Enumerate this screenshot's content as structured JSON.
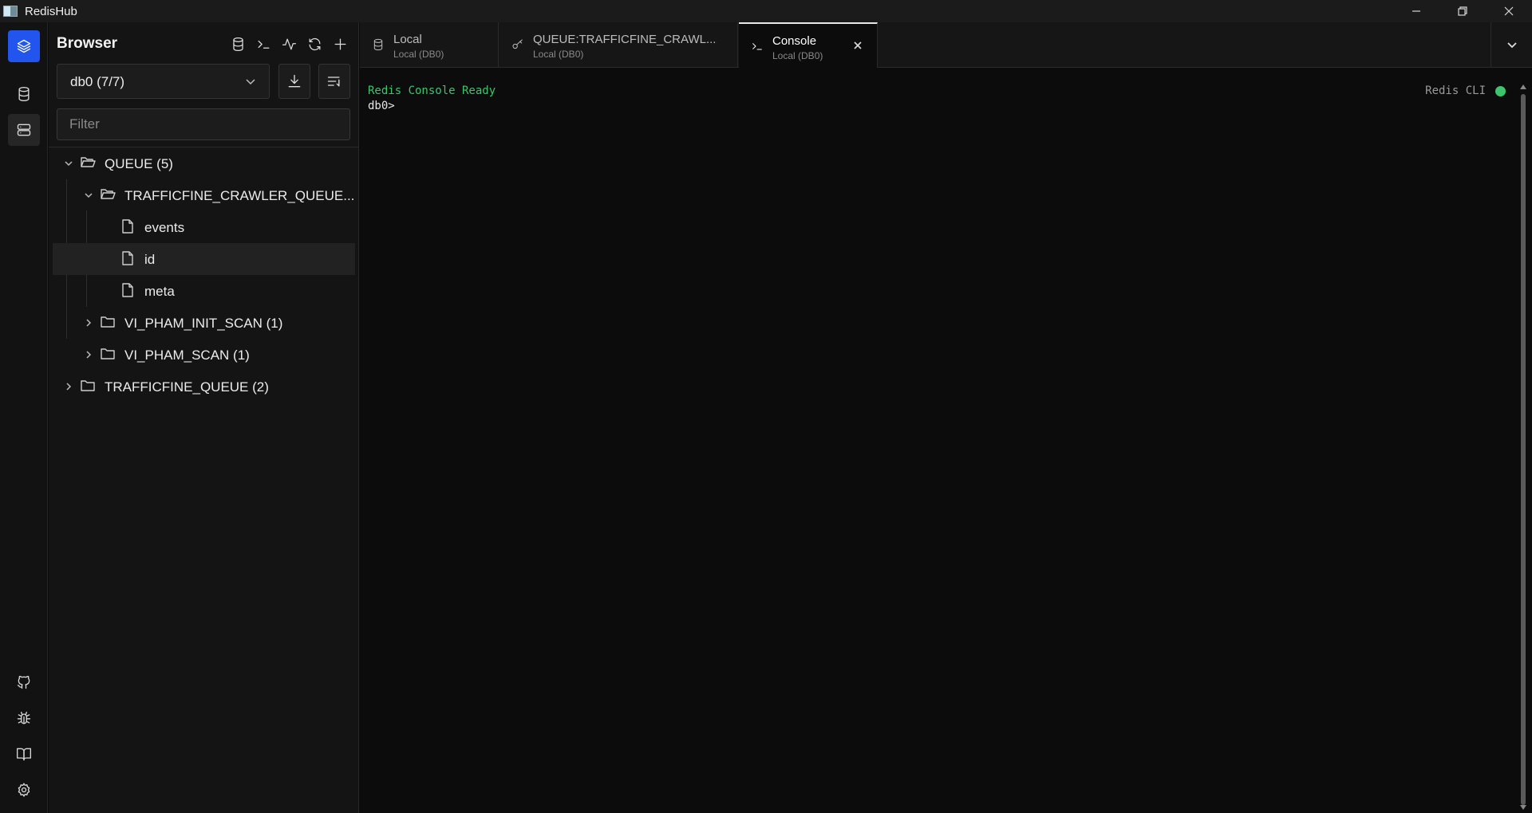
{
  "window": {
    "title": "RedisHub"
  },
  "activity_bar": {
    "top": [
      "layers-icon",
      "database-icon",
      "server-icon"
    ],
    "bottom": [
      "github-icon",
      "bug-icon",
      "book-icon",
      "gear-icon"
    ]
  },
  "sidebar": {
    "title": "Browser",
    "database_select": "db0 (7/7)",
    "filter_placeholder": "Filter",
    "tree": {
      "queue": "QUEUE (5)",
      "crawler_queue": "TRAFFICFINE_CRAWLER_QUEUE...",
      "events": "events",
      "id": "id",
      "meta": "meta",
      "init_scan": "VI_PHAM_INIT_SCAN (1)",
      "scan": "VI_PHAM_SCAN (1)",
      "trafficfine_queue": "TRAFFICFINE_QUEUE (2)"
    }
  },
  "tabs": [
    {
      "name": "Local",
      "sub": "Local (DB0)",
      "icon": "database-icon"
    },
    {
      "name": "QUEUE:TRAFFICFINE_CRAWL...",
      "sub": "Local (DB0)",
      "icon": "key-icon"
    },
    {
      "name": "Console",
      "sub": "Local (DB0)",
      "icon": "terminal-icon",
      "active": true
    }
  ],
  "console": {
    "ready_text": "Redis Console Ready",
    "prompt": "db0>",
    "status_label": "Redis CLI",
    "status_color": "#3ec46d"
  }
}
